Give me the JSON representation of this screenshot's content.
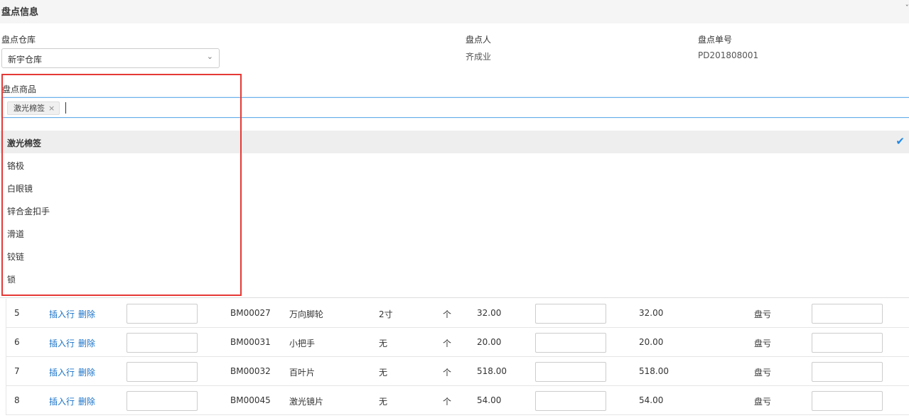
{
  "section": {
    "title": "盘点信息",
    "collapse_icon": "chevron-up-icon"
  },
  "form": {
    "warehouse_label": "盘点仓库",
    "warehouse_value": "新宇仓库",
    "person_label": "盘点人",
    "person_value": "齐成业",
    "order_label": "盘点单号",
    "order_value": "PD201808001",
    "goods_label": "盘点商品",
    "selected_tag": "激光棉签"
  },
  "dropdown": {
    "items": [
      {
        "label": "激光棉签",
        "selected": true
      },
      {
        "label": "铬极",
        "selected": false
      },
      {
        "label": "白眼镜",
        "selected": false
      },
      {
        "label": "锌合金扣手",
        "selected": false
      },
      {
        "label": "滑道",
        "selected": false
      },
      {
        "label": "铰链",
        "selected": false
      },
      {
        "label": "锁",
        "selected": false
      }
    ]
  },
  "table": {
    "insert_label": "插入行",
    "delete_label": "删除",
    "rows": [
      {
        "no": "5",
        "code": "BM00027",
        "name": "万向脚轮",
        "spec": "2寸",
        "unit": "个",
        "price": "32.00",
        "amount": "32.00",
        "status": "盘亏"
      },
      {
        "no": "6",
        "code": "BM00031",
        "name": "小把手",
        "spec": "无",
        "unit": "个",
        "price": "20.00",
        "amount": "20.00",
        "status": "盘亏"
      },
      {
        "no": "7",
        "code": "BM00032",
        "name": "百叶片",
        "spec": "无",
        "unit": "个",
        "price": "518.00",
        "amount": "518.00",
        "status": "盘亏"
      },
      {
        "no": "8",
        "code": "BM00045",
        "name": "激光镜片",
        "spec": "无",
        "unit": "个",
        "price": "54.00",
        "amount": "54.00",
        "status": "盘亏"
      }
    ]
  },
  "colors": {
    "link": "#1a73c9",
    "highlight": "#e53935",
    "check": "#1e88e5"
  }
}
